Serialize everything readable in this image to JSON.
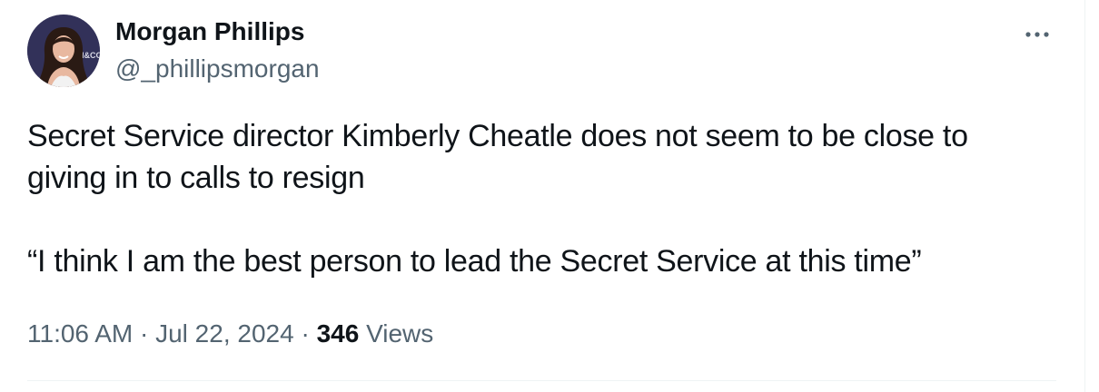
{
  "tweet": {
    "author": {
      "display_name": "Morgan Phillips",
      "handle": "@_phillipsmorgan",
      "avatar_backdrop_text": "I&CO"
    },
    "text_lines": [
      "Secret Service director Kimberly Cheatle does not seem to be close to",
      "giving in to calls to resign",
      "",
      "“I think I am the best person to lead the Secret Service at this time”"
    ],
    "timestamp": "11:06 AM · Jul 22, 2024",
    "separator": "·",
    "views_count": "346",
    "views_label": "Views",
    "more_icon": "more-horizontal-icon"
  },
  "colors": {
    "text_primary": "#0f1419",
    "text_secondary": "#536471",
    "divider": "#eff3f4",
    "avatar_backdrop": "#2b2b4e"
  }
}
